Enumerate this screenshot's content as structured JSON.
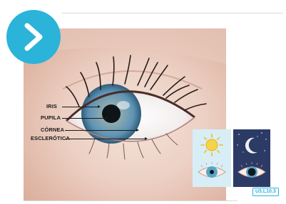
{
  "navigation": {
    "next_icon": "chevron-right-icon"
  },
  "figure": {
    "labels": [
      "IRIS",
      "PUPILA",
      "CÓRNEA",
      "ESCLERÓTICA"
    ]
  },
  "illumination_panels": {
    "day_icon": "sun-icon",
    "night_icon": "moon-icon"
  },
  "reference_code": "U3.L10.3",
  "colors": {
    "accent": "#2bb3d9",
    "night_panel": "#2c3a66",
    "day_panel": "#d8eef6"
  }
}
